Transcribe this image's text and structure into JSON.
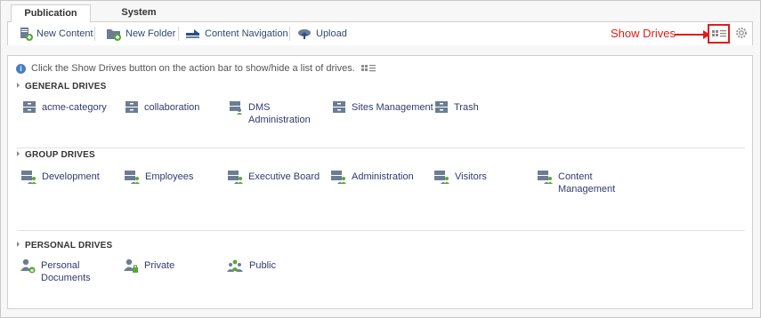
{
  "tabs": [
    {
      "label": "Publication",
      "active": true
    },
    {
      "label": "System",
      "active": false
    }
  ],
  "actions": {
    "new_content": "New Content",
    "new_folder": "New Folder",
    "content_navigation": "Content Navigation",
    "upload": "Upload"
  },
  "annotation": {
    "show_drives": "Show Drives"
  },
  "info": {
    "text": "Click the Show Drives button on the action bar to show/hide a list of drives."
  },
  "sections": {
    "general": {
      "title": "GENERAL DRIVES",
      "drives": [
        {
          "label": "acme-category",
          "icon": "drive-icon"
        },
        {
          "label": "collaboration",
          "icon": "drive-icon"
        },
        {
          "label": "DMS Administration",
          "icon": "drive-user-icon"
        },
        {
          "label": "Sites Management",
          "icon": "drive-icon"
        },
        {
          "label": "Trash",
          "icon": "drive-icon"
        }
      ]
    },
    "group": {
      "title": "GROUP DRIVES",
      "drives": [
        {
          "label": "Development",
          "icon": "group-drive-icon"
        },
        {
          "label": "Employees",
          "icon": "group-drive-icon"
        },
        {
          "label": "Executive Board",
          "icon": "group-drive-icon"
        },
        {
          "label": "Administration",
          "icon": "group-drive-icon"
        },
        {
          "label": "Visitors",
          "icon": "group-drive-icon"
        },
        {
          "label": "Content Management",
          "icon": "group-drive-icon"
        }
      ]
    },
    "personal": {
      "title": "PERSONAL DRIVES",
      "drives": [
        {
          "label": "Personal Documents",
          "icon": "personal-drive-icon"
        },
        {
          "label": "Private",
          "icon": "private-drive-icon"
        },
        {
          "label": "Public",
          "icon": "public-drive-icon"
        }
      ]
    }
  },
  "colors": {
    "accent": "#e31b1b",
    "link": "#2f3b6e",
    "info": "#4a7fc1",
    "green": "#5aa53a"
  }
}
